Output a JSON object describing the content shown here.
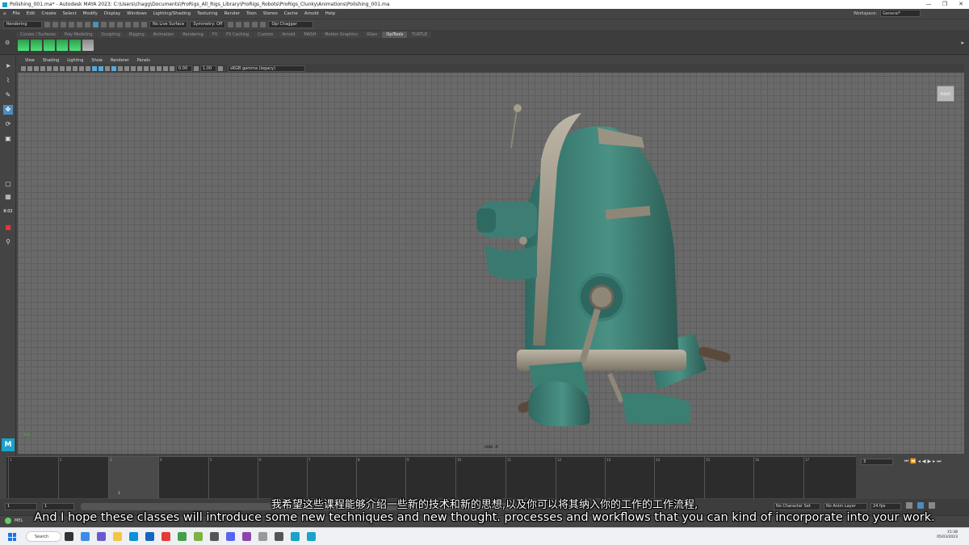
{
  "window": {
    "title": "Polishing_001.ma* - Autodesk MAYA 2023: C:\\Users\\chagg\\Documents\\ProRigs_All_Rigs_Library\\ProRigs_Robots\\ProRigs_Clunky\\Animations\\Polishing_001.ma"
  },
  "menubar": {
    "items": [
      "File",
      "Edit",
      "Create",
      "Select",
      "Modify",
      "Display",
      "Windows",
      "Lighting/Shading",
      "Texturing",
      "Render",
      "Toon",
      "Stereo",
      "Cache",
      "Arnold",
      "Help"
    ]
  },
  "workspace": {
    "label": "Workspace:",
    "value": "General*"
  },
  "statusline": {
    "menuset": "Rendering",
    "live_surface": "No Live Surface",
    "symmetry": "Symmetry: Off",
    "user": "Opi Chaggar"
  },
  "shelf": {
    "tabs": [
      "Curves / Surfaces",
      "Poly Modeling",
      "Sculpting",
      "Rigging",
      "Animation",
      "Rendering",
      "FX",
      "FX Caching",
      "Custom",
      "Arnold",
      "MASH",
      "Motion Graphics",
      "XGen",
      "OpiTools",
      "TURTLE"
    ],
    "active": "OpiTools"
  },
  "left_toolbar": {
    "timecode": "8:02"
  },
  "viewport": {
    "menus": [
      "View",
      "Shading",
      "Lighting",
      "Show",
      "Renderer",
      "Panels"
    ],
    "field_a": "0.00",
    "field_b": "1.00",
    "colorspace": "sRGB gamma (legacy)",
    "camera_label": "side -X",
    "viewcube_label": "RIGHT"
  },
  "timeline": {
    "ticks": [
      "1",
      "2",
      "3",
      "4",
      "5",
      "6",
      "7",
      "8",
      "9",
      "10",
      "11",
      "12",
      "13",
      "14",
      "15",
      "16",
      "17"
    ],
    "current_frame": "3"
  },
  "range": {
    "start": "1",
    "inner_start": "1",
    "char_set": "No Character Set",
    "anim_layer": "No Anim Layer",
    "fps": "24 fps"
  },
  "cmdline": {
    "label": "MEL"
  },
  "taskbar": {
    "search": "Search",
    "time": "15:38",
    "date": "05/03/2023"
  },
  "subtitles": {
    "zh": "我希望这些课程能够介绍一些新的技术和新的思想,以及你可以将其纳入你的工作的工作流程,",
    "en": "And I hope these classes will introduce some new techniques and new thought. processes and workflows that you can kind of incorporate into your work."
  },
  "colors": {
    "accent": "#4b8cc0",
    "robot_teal": "#3f8478",
    "maya_blue": "#1aa2c9"
  }
}
